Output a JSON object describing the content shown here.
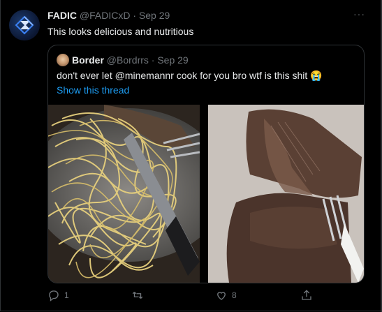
{
  "tweet": {
    "author_name": "FADIC",
    "author_handle": "@FADICxD",
    "date": "· Sep 29",
    "more_label": "···",
    "text": "This looks delicious and nutritious"
  },
  "quote": {
    "author_name": "Border",
    "author_handle": "@Bordrrs",
    "date": "· Sep 29",
    "text": "don't ever let @minemannr cook for you bro wtf is this shit 😭",
    "show_thread": "Show this thread"
  },
  "actions": {
    "reply_count": "1",
    "retweet_count": "",
    "like_count": "8"
  },
  "colors": {
    "background": "#000000",
    "text": "#e7e9ea",
    "muted": "#71767b",
    "link": "#1d9bf0",
    "border": "#2f3336"
  }
}
